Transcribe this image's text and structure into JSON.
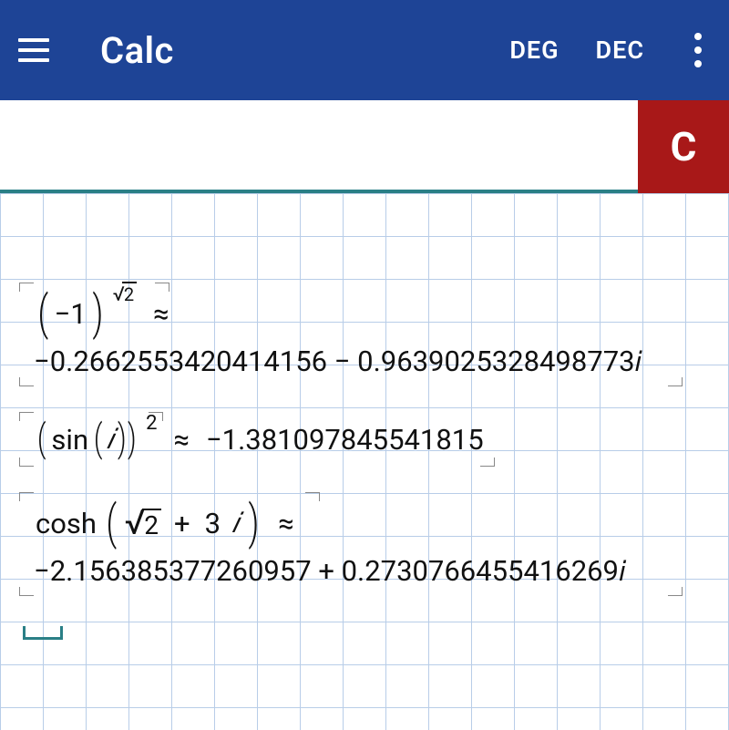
{
  "header": {
    "title": "Calc",
    "angle_mode": "DEG",
    "number_mode": "DEC"
  },
  "input": {
    "value": "",
    "clear_label": "C"
  },
  "results": [
    {
      "expr": {
        "base_open": "(",
        "base_neg": "−1",
        "base_close": ")",
        "exp_sqrt_radicand": "2",
        "approx": "≈"
      },
      "value": "−0.2662553420414156 − 0.9639025328498773𝑖"
    },
    {
      "expr": {
        "open": "(",
        "fn": "sin",
        "inner_open": "(",
        "inner_arg": "𝑖",
        "inner_close": ")",
        "close": ")",
        "exp": "2",
        "approx": "≈"
      },
      "value": "−1.381097845541815"
    },
    {
      "expr": {
        "fn": "cosh",
        "open": "(",
        "sqrt_radicand": "2",
        "plus": "+",
        "imag_coef": "3",
        "imag_i": "𝑖",
        "close": ")",
        "approx": "≈"
      },
      "value": "−2.156385377260957 + 0.2730766455416269𝑖"
    }
  ]
}
